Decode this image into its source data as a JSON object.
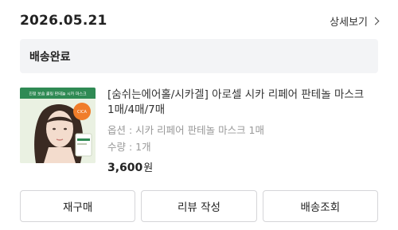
{
  "order": {
    "date": "2026.05.21",
    "detail_link": "상세보기",
    "status": "배송완료"
  },
  "product": {
    "name": "[숨쉬는에어홀/시카겔] 아로셀 시카 리페어 판테놀 마스크 1매/4매/7매",
    "option": "옵션 : 시카 리페어 판테놀 마스크 1매",
    "quantity": "수량 : 1개",
    "price": "3,600",
    "price_unit": "원",
    "image_icon": "product-thumbnail-mask",
    "thumb_text": "진정 보습 쿨링 판테놀 시카 마스크"
  },
  "actions": {
    "reorder": "재구매",
    "review": "리뷰 작성",
    "tracking": "배송조회"
  },
  "colors": {
    "status_bg": "#f3f4f6",
    "border": "#d5d5d8",
    "muted_text": "#999999",
    "thumb_bg": "#eaf1e2",
    "thumb_banner": "#2f8a54",
    "thumb_badge": "#f07d2a"
  }
}
